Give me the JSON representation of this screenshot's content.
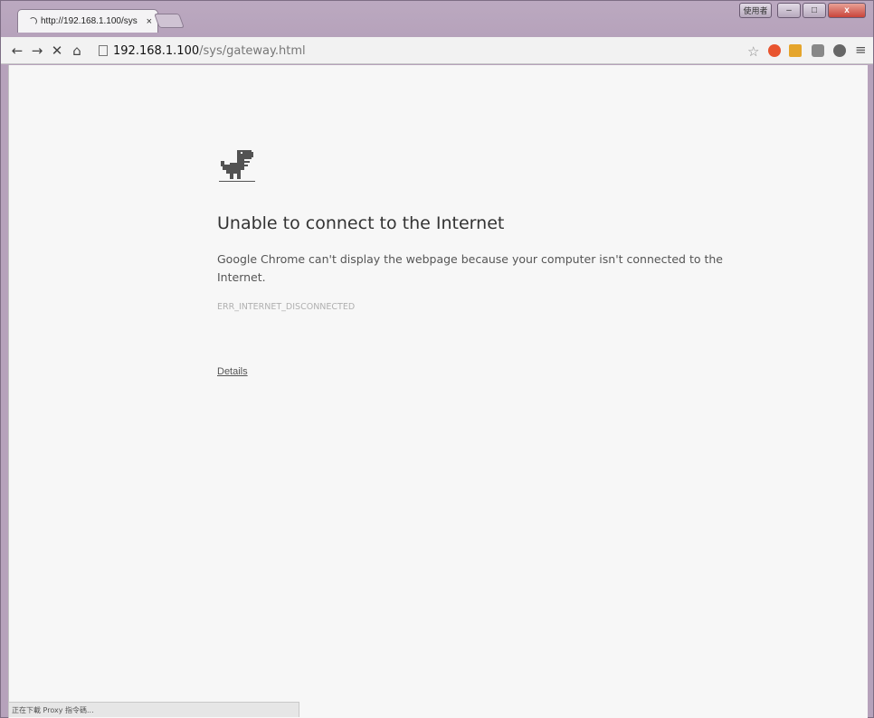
{
  "tab": {
    "title": "http://192.168.1.100/sys",
    "close_glyph": "×"
  },
  "window": {
    "user_button": "使用者",
    "min_glyph": "–",
    "max_glyph": "□",
    "close_glyph": "x"
  },
  "toolbar": {
    "back_glyph": "←",
    "forward_glyph": "→",
    "stop_glyph": "✕",
    "home_glyph": "⌂",
    "url_host": "192.168.1.100",
    "url_path": "/sys/gateway.html",
    "star_glyph": "☆",
    "menu_glyph": "≡"
  },
  "error_page": {
    "heading": "Unable to connect to the Internet",
    "description": "Google Chrome can't display the webpage because your computer isn't connected to the Internet.",
    "error_code": "ERR_INTERNET_DISCONNECTED",
    "details_link": "Details"
  },
  "status": {
    "text": "正在下載 Proxy 指令碼..."
  },
  "icons": {
    "spinner": "loading-spinner-icon",
    "page": "page-icon",
    "dino": "offline-dinosaur-icon",
    "extensions": [
      "red-extension-icon",
      "yellow-extension-icon",
      "puzzle-extension-icon",
      "gray-circle-extension-icon"
    ]
  },
  "colors": {
    "frame": "#b9a6bd",
    "content_bg": "#f7f7f7",
    "close_button": "#c9443a"
  }
}
